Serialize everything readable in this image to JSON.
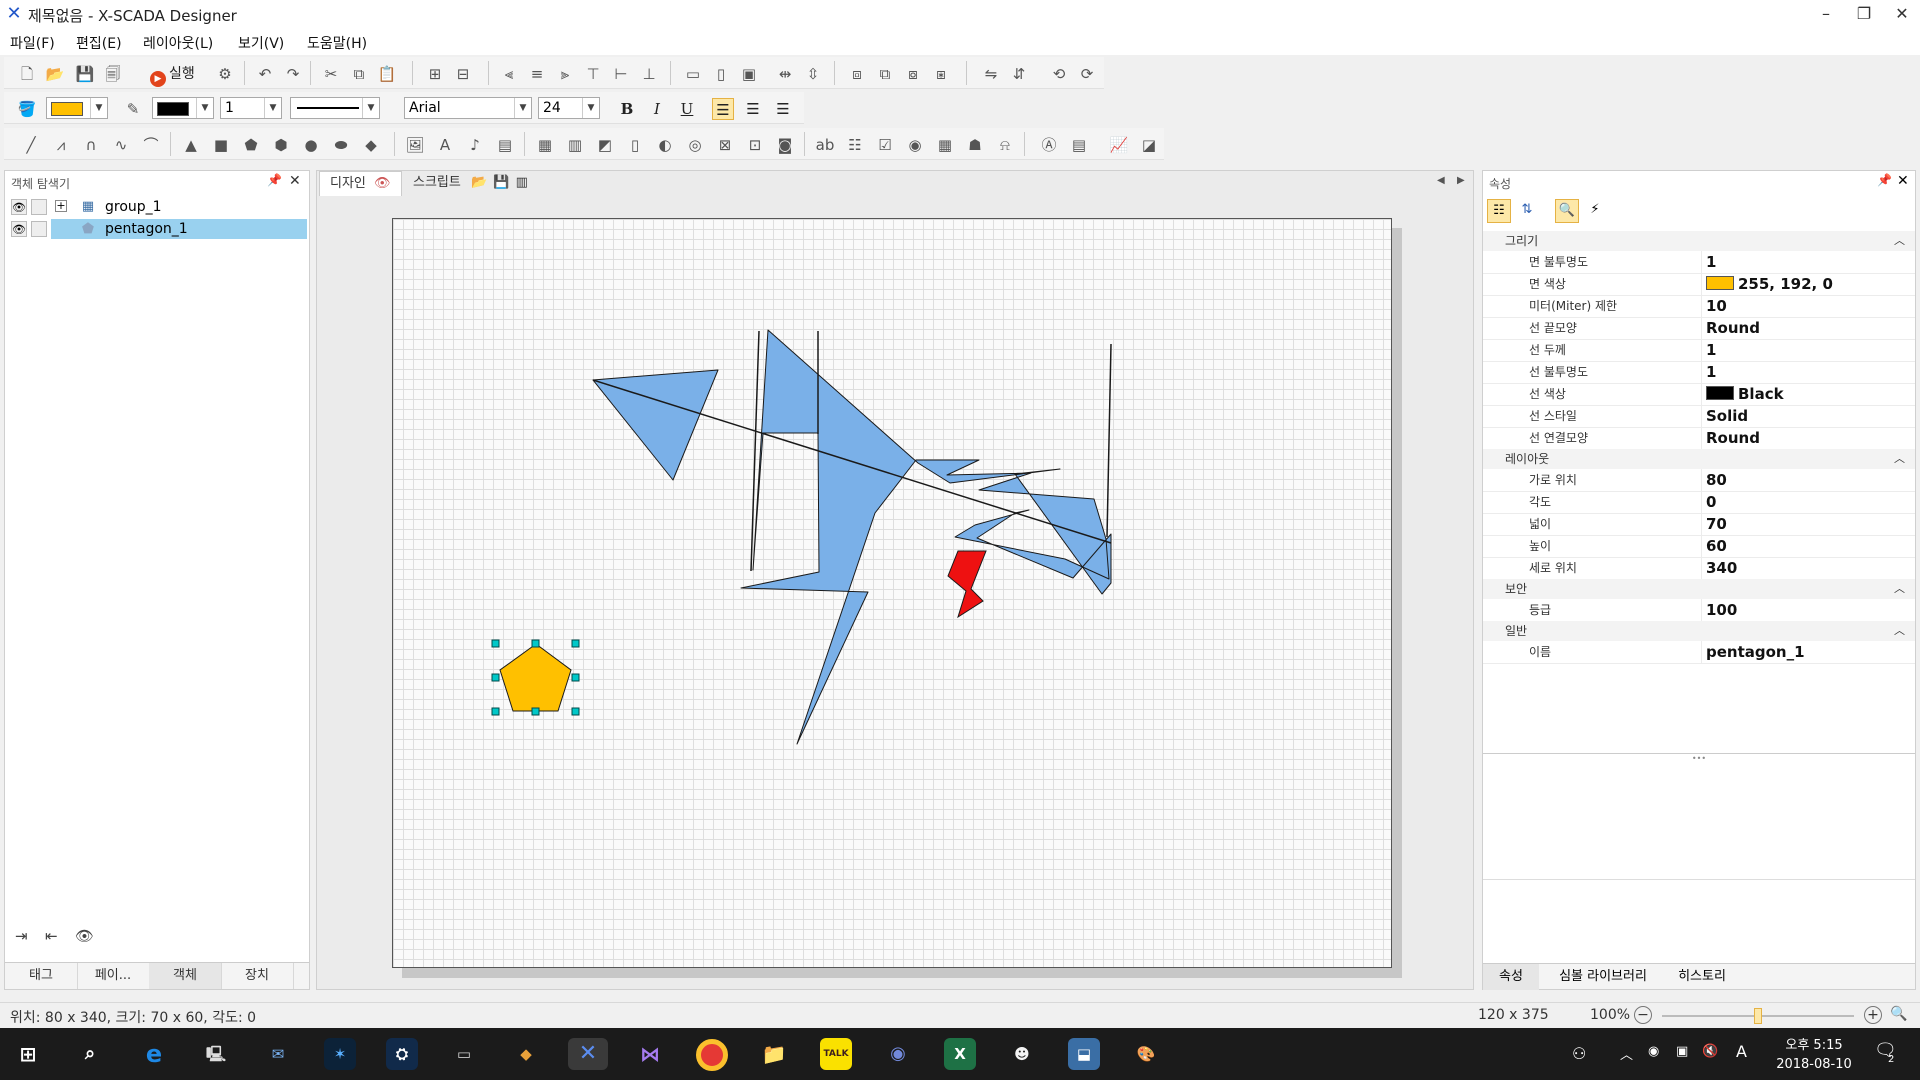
{
  "window": {
    "title": "제목없음 - X-SCADA Designer",
    "controls": {
      "minimize": "–",
      "restore": "❐",
      "close": "✕"
    }
  },
  "menu": [
    "파일(F)",
    "편집(E)",
    "레이아웃(L)",
    "보기(V)",
    "도움말(H)"
  ],
  "toolbar1": {
    "run_label": "실행"
  },
  "toolbar2": {
    "fill_color": "#ffc000",
    "line_color": "#000000",
    "line_width": "1",
    "font_family": "Arial",
    "font_size": "24",
    "bold": "B",
    "italic": "I",
    "underline": "U"
  },
  "object_explorer": {
    "title": "객체 탐색기",
    "items": [
      {
        "label": "group_1",
        "expand": "+",
        "selected": false
      },
      {
        "label": "pentagon_1",
        "expand": "",
        "selected": true
      }
    ],
    "tabs": [
      "태그",
      "페이...",
      "객체",
      "장치"
    ],
    "active_tab": 2
  },
  "document_tabs": [
    {
      "label": "디자인",
      "active": true
    },
    {
      "label": "스크립트",
      "active": false
    }
  ],
  "properties": {
    "title": "속성",
    "categories": [
      {
        "name": "그리기",
        "rows": [
          {
            "name": "면 불투명도",
            "value": "1"
          },
          {
            "name": "면 색상",
            "value": "255, 192, 0",
            "swatch": "#ffc000"
          },
          {
            "name": "미터(Miter) 제한",
            "value": "10"
          },
          {
            "name": "선 끝모양",
            "value": "Round"
          },
          {
            "name": "선 두께",
            "value": "1"
          },
          {
            "name": "선 불투명도",
            "value": "1"
          },
          {
            "name": "선 색상",
            "value": "Black",
            "swatch": "#000000"
          },
          {
            "name": "선 스타일",
            "value": "Solid"
          },
          {
            "name": "선 연결모양",
            "value": "Round"
          }
        ]
      },
      {
        "name": "레이아웃",
        "rows": [
          {
            "name": "가로 위치",
            "value": "80"
          },
          {
            "name": "각도",
            "value": "0"
          },
          {
            "name": "넓이",
            "value": "70"
          },
          {
            "name": "높이",
            "value": "60"
          },
          {
            "name": "세로 위치",
            "value": "340"
          }
        ]
      },
      {
        "name": "보안",
        "rows": [
          {
            "name": "등급",
            "value": "100"
          }
        ]
      },
      {
        "name": "일반",
        "rows": [
          {
            "name": "이름",
            "value": "pentagon_1"
          }
        ]
      }
    ],
    "tabs": [
      "속성",
      "심볼 라이브러리",
      "히스토리"
    ]
  },
  "status": {
    "left": "위치: 80 x 340, 크기: 70 x 60, 각도: 0",
    "cursor": "120 x 375",
    "zoom": "100%",
    "zoom_fraction": 0.5
  },
  "taskbar": {
    "time": "오후 5:15",
    "date": "2018-08-10",
    "notification_count": "2",
    "ime": "A",
    "kakao_label": "TALK"
  },
  "colors": {
    "shape_blue": "#7ab0e8",
    "shape_red": "#ee1111",
    "pentagon_fill": "#ffc000",
    "selection_handle": "#00c8c8"
  }
}
